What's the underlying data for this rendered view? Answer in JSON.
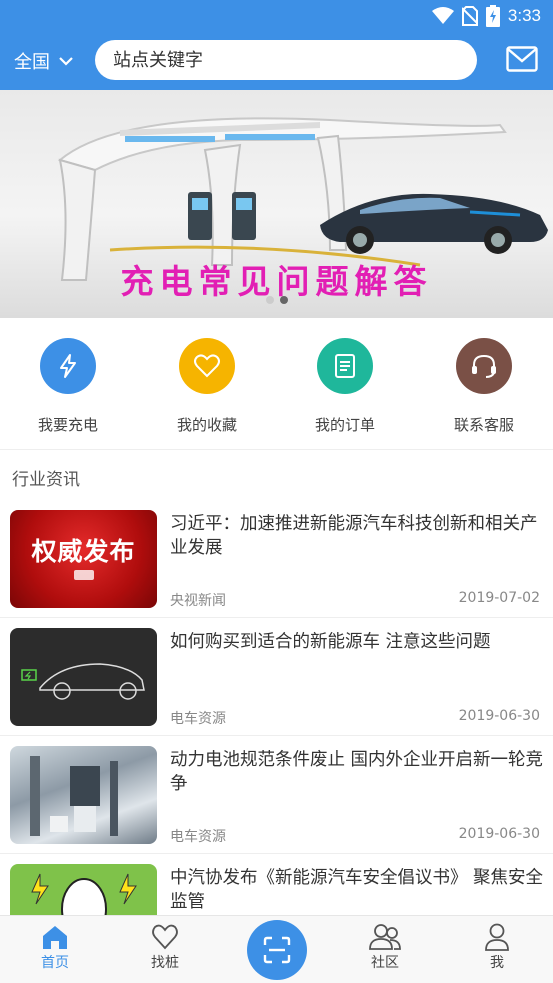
{
  "status": {
    "time": "3:33"
  },
  "header": {
    "region": "全国",
    "search_placeholder": "站点关键字"
  },
  "banner": {
    "caption": "充电常见问题解答",
    "slide_count": 2,
    "active_slide": 1
  },
  "quick_actions": [
    {
      "label": "我要充电",
      "icon": "lightning-icon",
      "color": "#3d90e6"
    },
    {
      "label": "我的收藏",
      "icon": "heart-icon",
      "color": "#f6b400"
    },
    {
      "label": "我的订单",
      "icon": "document-icon",
      "color": "#1fb79b"
    },
    {
      "label": "联系客服",
      "icon": "headset-icon",
      "color": "#7a5046"
    }
  ],
  "section": {
    "title": "行业资讯"
  },
  "news": [
    {
      "title": "习近平：加速推进新能源汽车科技创新和相关产业发展",
      "source": "央视新闻",
      "date": "2019-07-02",
      "thumb_text": "权威发布"
    },
    {
      "title": "如何购买到适合的新能源车 注意这些问题",
      "source": "电车资源",
      "date": "2019-06-30"
    },
    {
      "title": "动力电池规范条件废止 国内外企业开启新一轮竞争",
      "source": "电车资源",
      "date": "2019-06-30"
    },
    {
      "title": "中汽协发布《新能源汽车安全倡议书》 聚焦安全监管",
      "source": "",
      "date": ""
    }
  ],
  "bottom_nav": {
    "home": "首页",
    "find_pile": "找桩",
    "community": "社区",
    "me": "我"
  },
  "colors": {
    "primary": "#3d90e6",
    "caption_magenta": "#e21fb4"
  }
}
